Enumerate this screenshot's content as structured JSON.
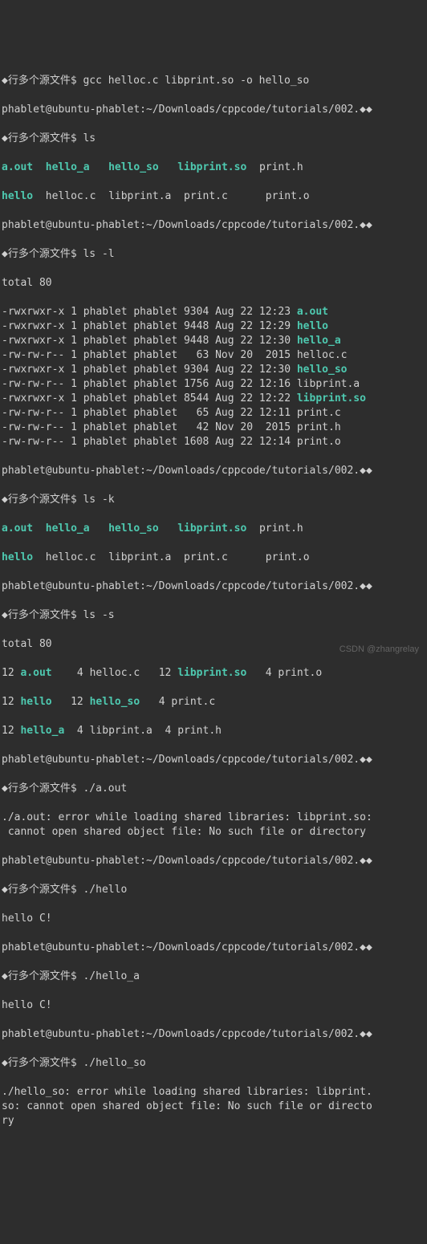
{
  "prompts": {
    "dir_prefix": "◆行多个源文件$ ",
    "user_host_path": "phablet@ubuntu-phablet:~/Downloads/cppcode/tutorials/002.◆◆"
  },
  "commands": {
    "gcc": "gcc helloc.c libprint.so -o hello_so",
    "ls": "ls",
    "ls_l": "ls -l",
    "ls_k": "ls -k",
    "ls_s": "ls -s",
    "run_aout": "./a.out",
    "run_hello": "./hello",
    "run_hello_a": "./hello_a",
    "run_hello_so": "./hello_so"
  },
  "ls_output": {
    "row1": {
      "aout": "a.out",
      "helloa": "hello_a",
      "helloso": "hello_so",
      "libprintso": "libprint.so",
      "printh": "print.h"
    },
    "row2": {
      "hello": "hello",
      "helloc": "helloc.c",
      "libprinta": "libprint.a",
      "printc": "print.c",
      "printo": "print.o"
    }
  },
  "ls_l": {
    "total": "total 80",
    "rows": [
      {
        "perm": "-rwxrwxr-x 1 phablet phablet 9304 Aug 22 12:23 ",
        "name": "a.out",
        "exec": true
      },
      {
        "perm": "-rwxrwxr-x 1 phablet phablet 9448 Aug 22 12:29 ",
        "name": "hello",
        "exec": true
      },
      {
        "perm": "-rwxrwxr-x 1 phablet phablet 9448 Aug 22 12:30 ",
        "name": "hello_a",
        "exec": true
      },
      {
        "perm": "-rw-rw-r-- 1 phablet phablet   63 Nov 20  2015 ",
        "name": "helloc.c",
        "exec": false
      },
      {
        "perm": "-rwxrwxr-x 1 phablet phablet 9304 Aug 22 12:30 ",
        "name": "hello_so",
        "exec": true
      },
      {
        "perm": "-rw-rw-r-- 1 phablet phablet 1756 Aug 22 12:16 ",
        "name": "libprint.a",
        "exec": false
      },
      {
        "perm": "-rwxrwxr-x 1 phablet phablet 8544 Aug 22 12:22 ",
        "name": "libprint.so",
        "exec": true
      },
      {
        "perm": "-rw-rw-r-- 1 phablet phablet   65 Aug 22 12:11 ",
        "name": "print.c",
        "exec": false
      },
      {
        "perm": "-rw-rw-r-- 1 phablet phablet   42 Nov 20  2015 ",
        "name": "print.h",
        "exec": false
      },
      {
        "perm": "-rw-rw-r-- 1 phablet phablet 1608 Aug 22 12:14 ",
        "name": "print.o",
        "exec": false
      }
    ]
  },
  "ls_s": {
    "total": "total 80",
    "r1": {
      "s1": "12 ",
      "n1": "a.out",
      "s2": "    4 ",
      "n2": "helloc.c",
      "s3": "   12 ",
      "n3": "libprint.so",
      "s4": "   4 ",
      "n4": "print.o"
    },
    "r2": {
      "s1": "12 ",
      "n1": "hello",
      "s2": "   12 ",
      "n2": "hello_so",
      "s3": "   4 ",
      "n3": "print.c"
    },
    "r3": {
      "s1": "12 ",
      "n1": "hello_a",
      "s2": "  4 ",
      "n2": "libprint.a",
      "s3": "  4 ",
      "n3": "print.h"
    }
  },
  "errors": {
    "aout": "./a.out: error while loading shared libraries: libprint.so:\n cannot open shared object file: No such file or directory",
    "helloso": "./hello_so: error while loading shared libraries: libprint.\nso: cannot open shared object file: No such file or directo\nry"
  },
  "output": {
    "helloc": "hello C!"
  },
  "watermark": "CSDN @zhangrelay"
}
